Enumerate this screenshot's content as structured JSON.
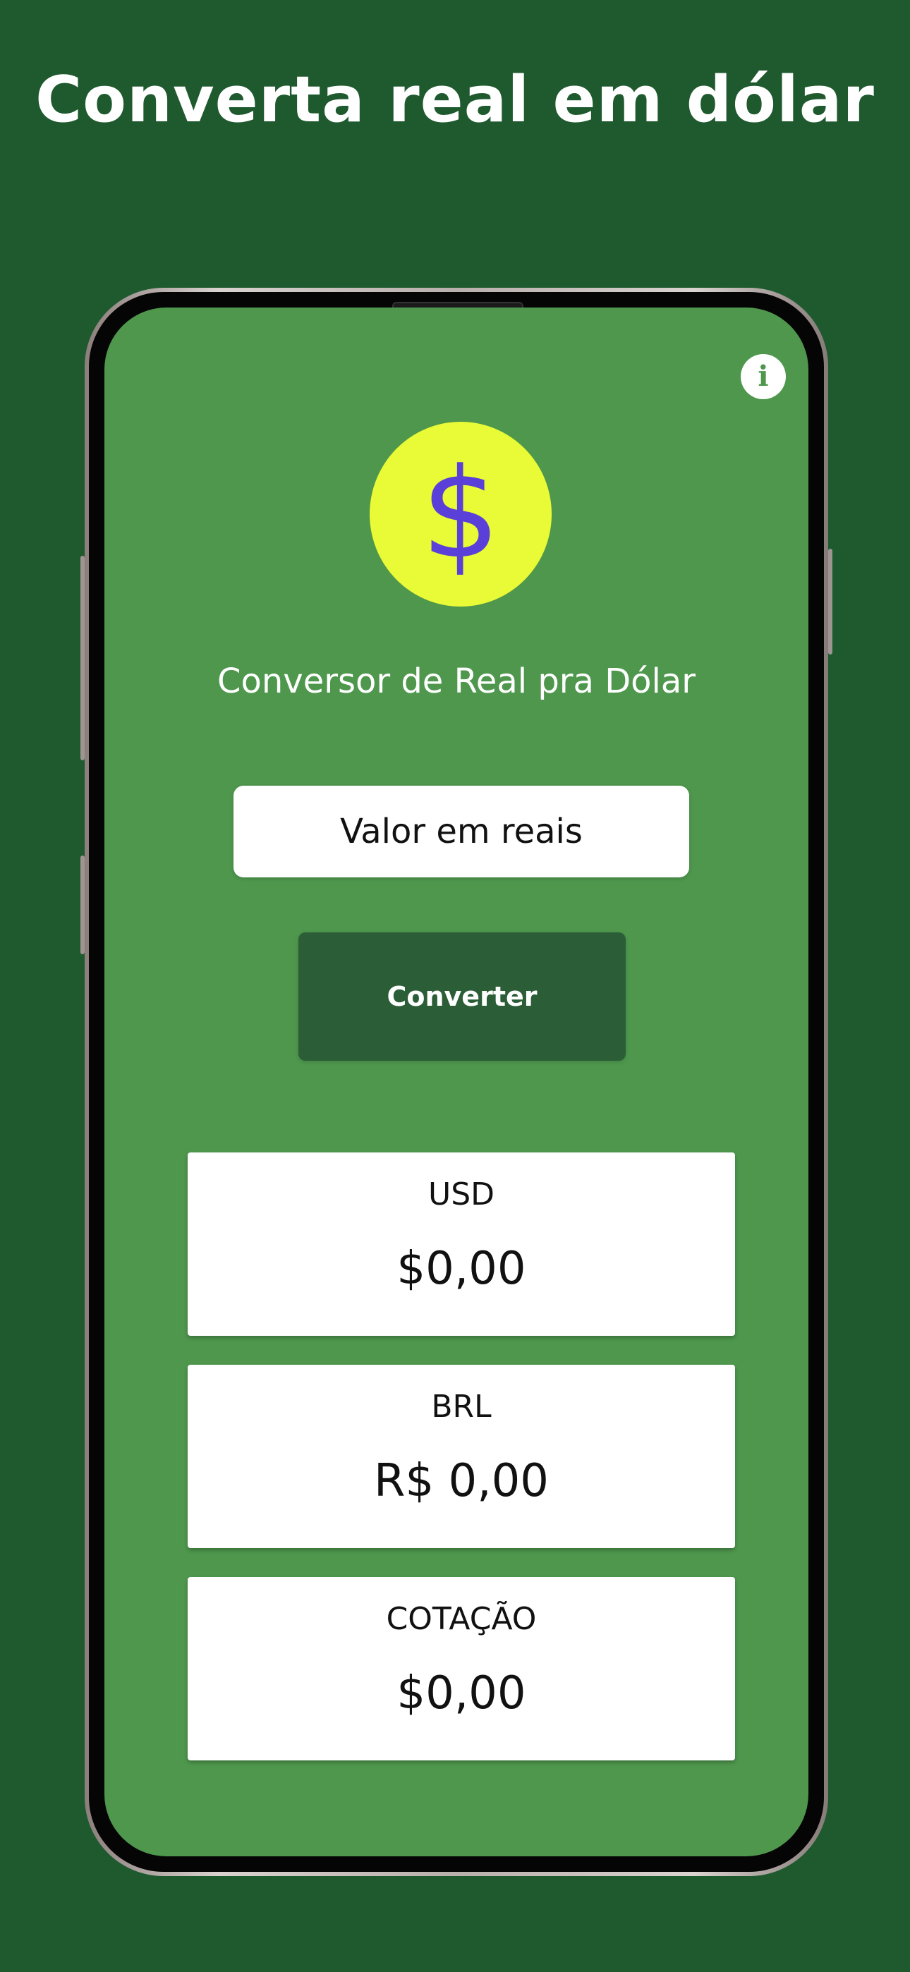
{
  "headline": "Converta real em dólar",
  "app": {
    "title": "Conversor de Real pra Dólar",
    "logo_symbol": "$",
    "info_symbol": "i",
    "input_placeholder": "Valor em reais",
    "convert_label": "Converter"
  },
  "results": [
    {
      "label": "USD",
      "value": "$0,00"
    },
    {
      "label": "BRL",
      "value": "R$ 0,00"
    },
    {
      "label": "COTAÇÃO",
      "value": "$0,00"
    }
  ],
  "colors": {
    "background": "#1f5a2f",
    "screen": "#4e974d",
    "logo_circle": "#e8fb36",
    "logo_symbol": "#5a3fd8",
    "button": "#2b5e37"
  }
}
